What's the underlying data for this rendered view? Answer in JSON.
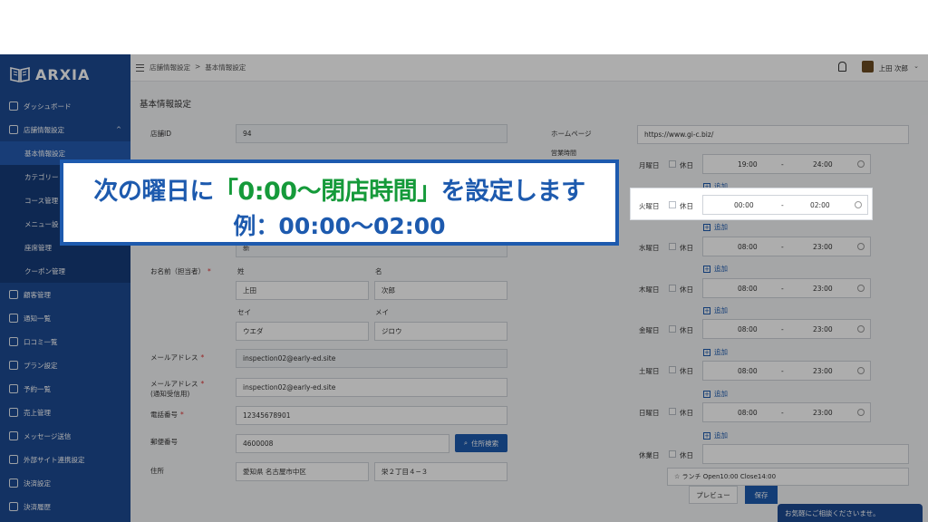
{
  "app": {
    "brand": "ARXIA"
  },
  "sidebar": {
    "items": [
      {
        "label": "ダッシュボード"
      },
      {
        "label": "店舗情報設定"
      },
      {
        "label": "顧客管理"
      },
      {
        "label": "通知一覧"
      },
      {
        "label": "口コミ一覧"
      },
      {
        "label": "プラン設定"
      },
      {
        "label": "予約一覧"
      },
      {
        "label": "売上管理"
      },
      {
        "label": "メッセージ送信"
      },
      {
        "label": "外部サイト連携設定"
      },
      {
        "label": "決済設定"
      },
      {
        "label": "決済履歴"
      }
    ],
    "sub_items": [
      {
        "label": "基本情報設定"
      },
      {
        "label": "カテゴリー"
      },
      {
        "label": "コース管理"
      },
      {
        "label": "メニュー設"
      },
      {
        "label": "座席管理"
      },
      {
        "label": "クーポン管理"
      }
    ]
  },
  "topbar": {
    "breadcrumb": [
      "店舗情報設定",
      ">",
      "基本情報設定"
    ],
    "user_name": "上田 次郎"
  },
  "page": {
    "title": "基本情報設定",
    "shop_id_label": "店舗ID",
    "shop_id": "94",
    "kanji_value": "新",
    "contact_label": "お名前（担当者）",
    "sei_label": "姓",
    "mei_label": "名",
    "sei": "上田",
    "mei": "次郎",
    "sei_kana_label": "セイ",
    "mei_kana_label": "メイ",
    "sei_kana": "ウエダ",
    "mei_kana": "ジロウ",
    "email_label": "メールアドレス",
    "email": "inspection02@early-ed.site",
    "email_notify_label_1": "メールアドレス",
    "email_notify_label_2": "(通知受信用)",
    "email_notify": "inspection02@early-ed.site",
    "phone_label": "電話番号",
    "phone": "12345678901",
    "zip_label": "郵便番号",
    "zip": "4600008",
    "zip_button": "住所検索",
    "address_label": "住所",
    "address_1": "愛知県 名古屋市中区",
    "address_2": "栄２丁目４−３",
    "homepage_label": "ホームページ",
    "homepage": "https://www.gi-c.biz/",
    "hours_label": "営業時間",
    "holiday_label": "休日",
    "add_label": "追加",
    "days": [
      {
        "day": "月曜日",
        "open": "19:00",
        "close": "24:00"
      },
      {
        "day": "水曜日",
        "open": "08:00",
        "close": "23:00"
      },
      {
        "day": "木曜日",
        "open": "08:00",
        "close": "23:00"
      },
      {
        "day": "金曜日",
        "open": "08:00",
        "close": "23:00"
      },
      {
        "day": "土曜日",
        "open": "08:00",
        "close": "23:00"
      },
      {
        "day": "日曜日",
        "open": "08:00",
        "close": "23:00"
      }
    ],
    "highlight_day": {
      "day": "火曜日",
      "open": "00:00",
      "close": "02:00"
    },
    "dash": "-",
    "holiday_day_label": "休業日",
    "memo": "☆ ランチ Open10:00  Close14:00",
    "preview_button": "プレビュー",
    "save_button": "保存",
    "chat_tab": "お気軽にご相談くださいませ。"
  },
  "instruction": {
    "line1_a": "次の曜日に",
    "line1_b": "「0:00〜閉店時間」",
    "line1_c": "を設定します",
    "line2": "例：00:00〜02:00"
  },
  "colors": {
    "sidebar": "#1d4a93",
    "accent": "#1d5aae",
    "highlight_green": "#159a3a"
  }
}
